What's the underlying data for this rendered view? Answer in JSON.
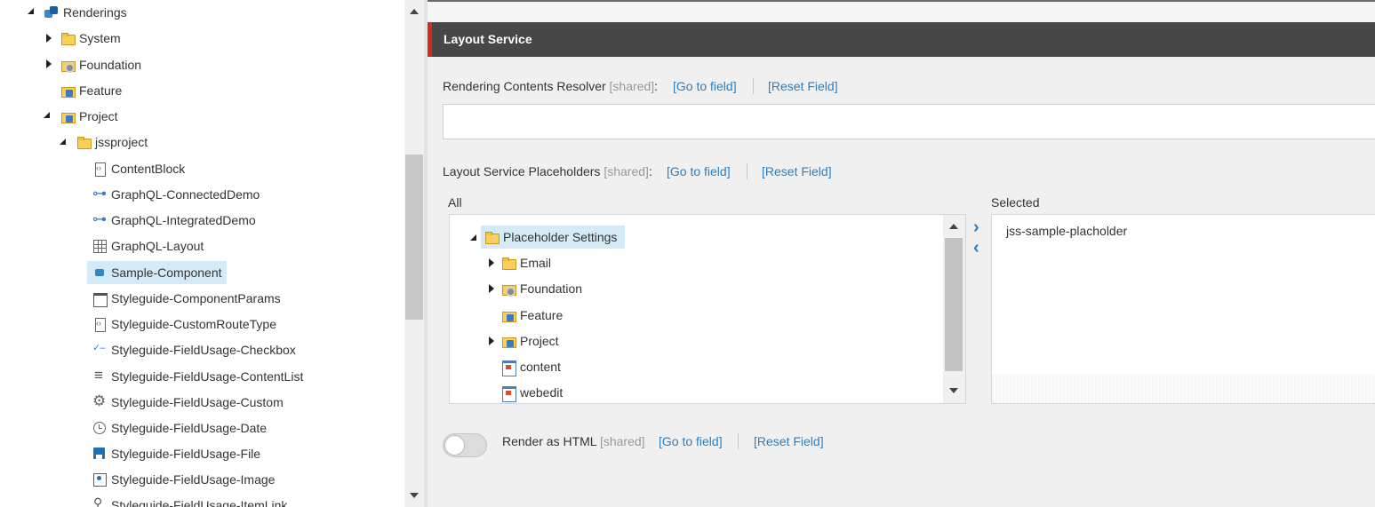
{
  "tree": {
    "items": [
      {
        "label": "Renderings",
        "icon": "renderings-icon",
        "state": "expanded"
      },
      {
        "label": "System",
        "icon": "folder-icon",
        "state": "collapsed"
      },
      {
        "label": "Foundation",
        "icon": "folder-gear-icon",
        "state": "collapsed"
      },
      {
        "label": "Feature",
        "icon": "folder-feature-icon",
        "state": "leaf"
      },
      {
        "label": "Project",
        "icon": "folder-project-icon",
        "state": "expanded"
      },
      {
        "label": "jssproject",
        "icon": "folder-icon",
        "state": "expanded"
      },
      {
        "label": "ContentBlock",
        "icon": "document-icon",
        "state": "leaf"
      },
      {
        "label": "GraphQL-ConnectedDemo",
        "icon": "link-icon",
        "state": "leaf"
      },
      {
        "label": "GraphQL-IntegratedDemo",
        "icon": "link-icon",
        "state": "leaf"
      },
      {
        "label": "GraphQL-Layout",
        "icon": "grid-icon",
        "state": "leaf"
      },
      {
        "label": "Sample-Component",
        "icon": "component-icon",
        "state": "selected"
      },
      {
        "label": "Styleguide-ComponentParams",
        "icon": "params-icon",
        "state": "leaf"
      },
      {
        "label": "Styleguide-CustomRouteType",
        "icon": "document-icon",
        "state": "leaf"
      },
      {
        "label": "Styleguide-FieldUsage-Checkbox",
        "icon": "checkbox-icon",
        "state": "leaf"
      },
      {
        "label": "Styleguide-FieldUsage-ContentList",
        "icon": "list-icon",
        "state": "leaf"
      },
      {
        "label": "Styleguide-FieldUsage-Custom",
        "icon": "gear-icon",
        "state": "leaf"
      },
      {
        "label": "Styleguide-FieldUsage-Date",
        "icon": "clock-icon",
        "state": "leaf"
      },
      {
        "label": "Styleguide-FieldUsage-File",
        "icon": "save-icon",
        "state": "leaf"
      },
      {
        "label": "Styleguide-FieldUsage-Image",
        "icon": "image-icon",
        "state": "leaf"
      },
      {
        "label": "Styleguide-FieldUsage-ItemLink",
        "icon": "item-link-icon",
        "state": "leaf"
      }
    ]
  },
  "section": {
    "title": "Layout Service",
    "accent_color": "#d42a1e",
    "header_color": "#474747"
  },
  "fields": {
    "resolver": {
      "label": "Rendering Contents Resolver",
      "shared": "[shared]",
      "colon": ":",
      "goto": "[Go to field]",
      "reset": "[Reset Field]",
      "value": ""
    },
    "placeholders": {
      "label": "Layout Service Placeholders",
      "shared": "[shared]",
      "colon": ":",
      "goto": "[Go to field]",
      "reset": "[Reset Field]",
      "all_label": "All",
      "selected_label": "Selected",
      "all_items": [
        {
          "label": "Placeholder Settings",
          "state": "expanded",
          "selected": true
        },
        {
          "label": "Email",
          "state": "collapsed"
        },
        {
          "label": "Foundation",
          "state": "collapsed"
        },
        {
          "label": "Feature",
          "state": "leaf"
        },
        {
          "label": "Project",
          "state": "collapsed"
        },
        {
          "label": "content",
          "state": "leaf"
        },
        {
          "label": "webedit",
          "state": "leaf"
        }
      ],
      "selected_items": [
        "jss-sample-placholder"
      ],
      "move_right": "›",
      "move_left": "‹"
    },
    "render_html": {
      "label": "Render as HTML",
      "shared": "[shared]",
      "goto": "[Go to field]",
      "reset": "[Reset Field]",
      "enabled": false
    }
  }
}
